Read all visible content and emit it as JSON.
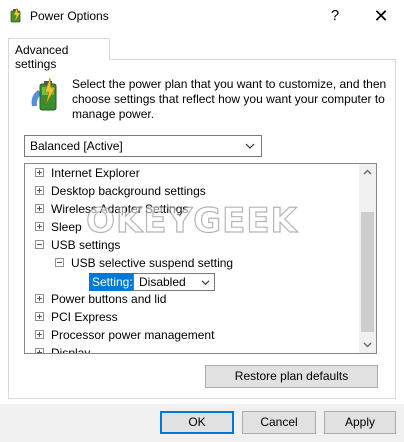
{
  "window": {
    "title": "Power Options",
    "help_label": "?",
    "close_label": "✕"
  },
  "tab": {
    "label": "Advanced settings"
  },
  "description": "Select the power plan that you want to customize, and then choose settings that reflect how you want your computer to manage power.",
  "plan": {
    "selected": "Balanced [Active]"
  },
  "tree": {
    "items": [
      {
        "label": "Internet Explorer",
        "expander": "plus"
      },
      {
        "label": "Desktop background settings",
        "expander": "plus"
      },
      {
        "label": "Wireless Adapter Settings",
        "expander": "plus"
      },
      {
        "label": "Sleep",
        "expander": "plus"
      },
      {
        "label": "USB settings",
        "expander": "minus"
      },
      {
        "label": "USB selective suspend setting",
        "expander": "minus"
      },
      {
        "label": "Power buttons and lid",
        "expander": "plus"
      },
      {
        "label": "PCI Express",
        "expander": "plus"
      },
      {
        "label": "Processor power management",
        "expander": "plus"
      },
      {
        "label": "Display",
        "expander": "plus"
      }
    ],
    "setting": {
      "label": "Setting:",
      "value": "Disabled"
    }
  },
  "watermark": "OKEYGEEK",
  "buttons": {
    "restore": "Restore plan defaults",
    "ok": "OK",
    "cancel": "Cancel",
    "apply": "Apply"
  },
  "colors": {
    "selection": "#0078d7",
    "button_face": "#e1e1e1",
    "footer": "#f0f0f0"
  }
}
